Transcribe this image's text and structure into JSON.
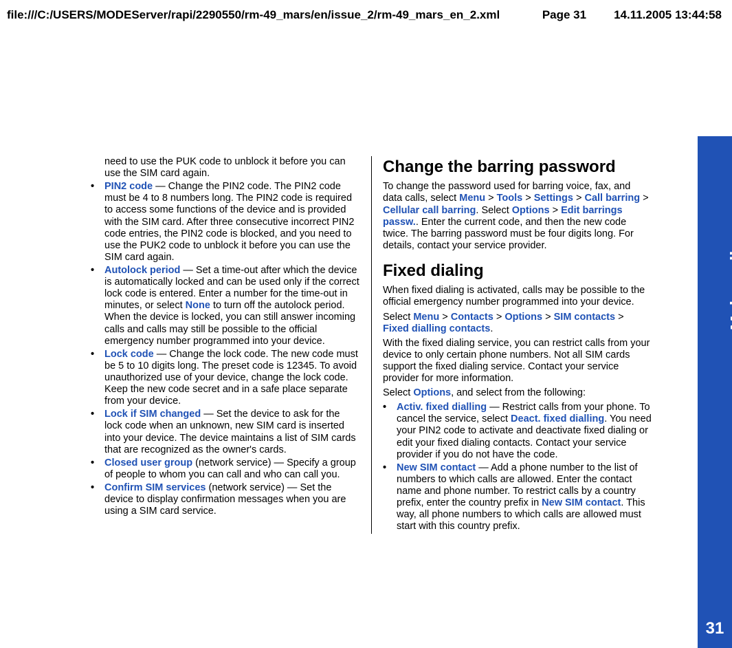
{
  "header": {
    "path": "file:///C:/USERS/MODEServer/rapi/2290550/rm-49_mars/en/issue_2/rm-49_mars_en_2.xml",
    "page": "Page 31",
    "datetime": "14.11.2005 13:44:58"
  },
  "side": {
    "label": "Make calls",
    "pagenum": "31"
  },
  "col1": {
    "intro": "need to use the PUK code to unblock it before you can use the SIM card again.",
    "items": [
      {
        "term": "PIN2 code",
        "text": " — Change the PIN2 code. The PIN2 code must be 4 to 8 numbers long. The PIN2 code is required to access some functions of the device and is provided with the SIM card. After three consecutive incorrect PIN2 code entries, the PIN2 code is blocked, and you need to use the PUK2 code to unblock it before you can use the SIM card again."
      },
      {
        "term": "Autolock period",
        "text": "  — Set a time-out after which the device is automatically locked and can be used only if the correct lock code is entered. Enter a number for the time-out in minutes, or select ",
        "inline": "None",
        "tail": " to turn off the autolock period. When the device is locked, you can still answer incoming calls and calls may still be possible to the official emergency number programmed into your device."
      },
      {
        "term": "Lock code",
        "text": " — Change the lock code. The new code must be 5 to 10 digits long. The preset code is 12345. To avoid unauthorized use of your device, change the lock code. Keep the new code secret and in a safe place separate from your device."
      },
      {
        "term": "Lock if SIM changed",
        "text": " — Set the device to ask for the lock code when an unknown, new SIM card is inserted into your device. The device maintains a list of SIM cards that are recognized as the owner's cards."
      },
      {
        "term": "Closed user group",
        "text": " (network service) — Specify a group of people to whom you can call and who can call you."
      },
      {
        "term": "Confirm SIM services",
        "text": " (network service) — Set the device to display confirmation messages when you are using a SIM card service."
      }
    ]
  },
  "col2": {
    "h1": "Change the barring password",
    "p1a": "To change the password used for barring voice, fax, and data calls, select ",
    "nav1": [
      "Menu",
      "Tools",
      "Settings",
      "Call barring",
      "Cellular call barring"
    ],
    "p1b": ". Select ",
    "nav2": [
      "Options",
      "Edit barrings passw."
    ],
    "p1c": ". Enter the current code, and then the new code twice. The barring password must be four digits long. For details, contact your service provider.",
    "h2": "Fixed dialing",
    "p2": "When fixed dialing is activated, calls may be possible to the official emergency number programmed into your device.",
    "p3a": "Select ",
    "nav3": [
      "Menu",
      "Contacts",
      "Options",
      "SIM contacts",
      "Fixed dialling contacts"
    ],
    "p3b": ".",
    "p4": "With the fixed dialing service, you can restrict calls from your device to only certain phone numbers. Not all SIM cards support the fixed dialing service. Contact your service provider for more information.",
    "p5a": "Select ",
    "p5opt": "Options",
    "p5b": ", and select from the following:",
    "items": [
      {
        "term": "Activ. fixed dialling",
        "text": " — Restrict calls from your phone. To cancel the service, select ",
        "inline": "Deact. fixed dialling",
        "tail": ". You need your PIN2 code to activate and deactivate fixed dialing or edit your fixed dialing contacts. Contact your service provider if you do not have the code."
      },
      {
        "term": "New SIM contact",
        "text": " — Add a phone number to the list of numbers to which calls are allowed. Enter the contact name and phone number. To restrict calls by a country prefix, enter the country prefix in ",
        "inline": "New SIM contact",
        "tail": ". This way, all phone numbers to which calls are allowed must start with this country prefix."
      }
    ]
  },
  "gt": ">"
}
